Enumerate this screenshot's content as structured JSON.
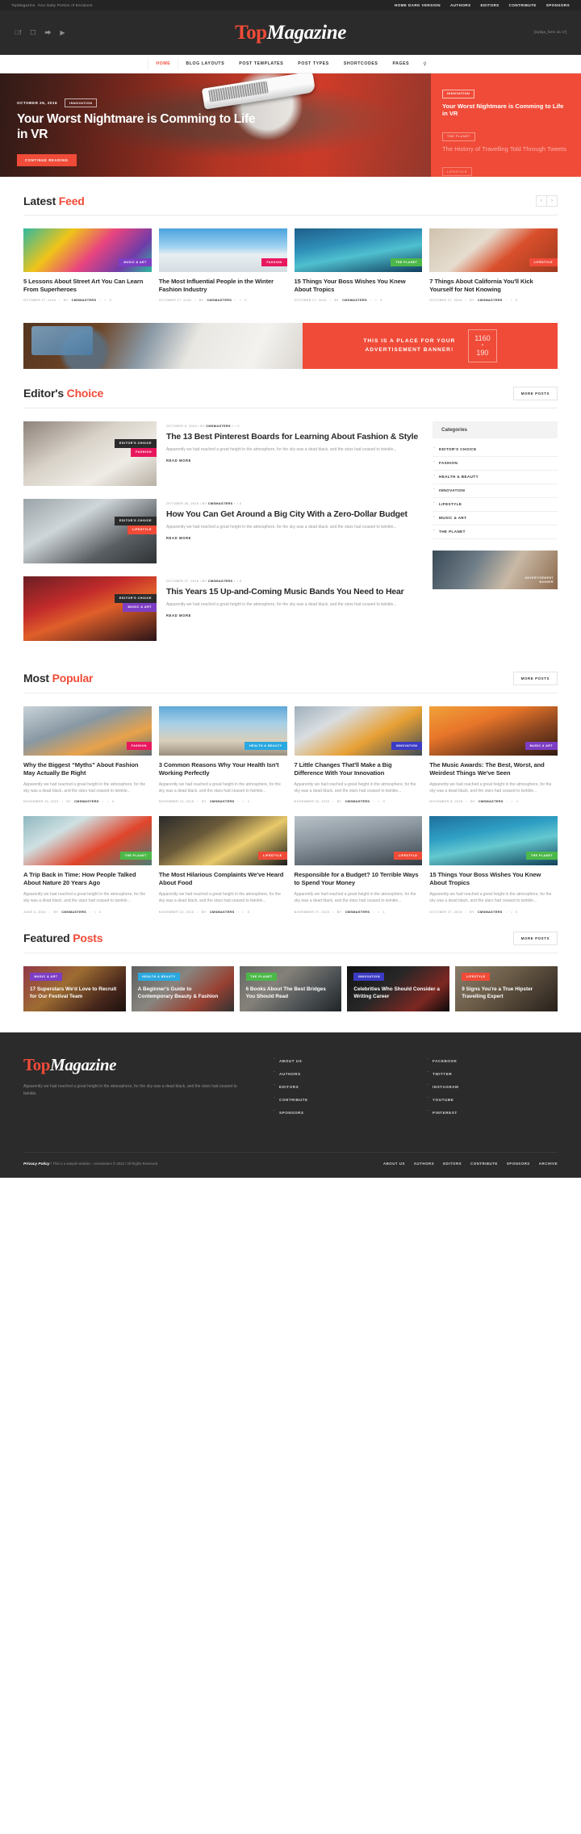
{
  "topbar": {
    "tagline": "TopMagazine. Your Daily Portion of Emotions.",
    "menu": [
      "HOME DARK VERSION",
      "AUTHORS",
      "EDITORS",
      "CONTRIBUTE",
      "SPONSORS"
    ]
  },
  "header": {
    "brand_1": "Top",
    "brand_2": "Magazine",
    "social": [
      "facebook-icon",
      "instagram-icon",
      "twitter-icon",
      "youtube-icon"
    ],
    "right_text": "[wysija_form id='2']"
  },
  "nav": {
    "items": [
      "HOME",
      "BLOG LAYOUTS",
      "POST TEMPLATES",
      "POST TYPES",
      "SHORTCODES",
      "PAGES"
    ],
    "active": "HOME",
    "search_icon": "search-icon"
  },
  "hero": {
    "date": "OCTOBER 26, 2016",
    "tag": "INNOVATION",
    "title": "Your Worst Nightmare is Comming to Life in VR",
    "button": "CONTINUE READING",
    "side": [
      {
        "tag": "INNOVATION",
        "title": "Your Worst Nightmare is Comming to Life in VR"
      },
      {
        "tag": "THE PLANET",
        "title": "The History of Travelling Told Through Tweets"
      },
      {
        "tag": "LIFESTYLE",
        "title": ""
      }
    ]
  },
  "latest_feed": {
    "title_1": "Latest",
    "title_2": "Feed",
    "prev": "‹",
    "next": "›",
    "cards": [
      {
        "badge": "MUSIC & ART",
        "badge_color": "#7d3ec4",
        "title": "5 Lessons About Street Art You Can Learn From Superheroes",
        "date": "OCTOBER 27, 2016",
        "author": "CMSMASTERS",
        "comments": "0"
      },
      {
        "badge": "FASHION",
        "badge_color": "#e8185e",
        "title": "The Most Influential People in the Winter Fashion Industry",
        "date": "OCTOBER 27, 2016",
        "author": "CMSMASTERS",
        "comments": "0"
      },
      {
        "badge": "THE PLANET",
        "badge_color": "#4cb849",
        "title": "15 Things Your Boss Wishes You Knew About Tropics",
        "date": "OCTOBER 27, 2016",
        "author": "CMSMASTERS",
        "comments": "0"
      },
      {
        "badge": "LIFESTYLE",
        "badge_color": "#f04b38",
        "title": "7 Things About California You'll Kick Yourself for Not Knowing",
        "date": "OCTOBER 27, 2016",
        "author": "CMSMASTERS",
        "comments": "0"
      }
    ]
  },
  "ad_banner": {
    "text_line1": "THIS IS A PLACE FOR YOUR",
    "text_line2": "ADVERTISEMENT BANNER!",
    "size_w": "1160",
    "size_x": "×",
    "size_h": "190"
  },
  "editors_choice": {
    "title_1": "Editor's",
    "title_2": "Choice",
    "more": "MORE POSTS",
    "posts": [
      {
        "badge_main": "EDITOR'S CHOICE",
        "badge_cat": "FASHION",
        "badge_color": "#e8185e",
        "date": "OCTOBER 5, 2015",
        "author": "CMSMASTERS",
        "comments": "0",
        "title": "The 13 Best Pinterest Boards for Learning About Fashion & Style",
        "excerpt": "Apparently we had reached a great height in the atmosphere, for the sky was a dead black, and the stars had ceased to twinkle...",
        "read_more": "READ MORE"
      },
      {
        "badge_main": "EDITOR'S CHOICE",
        "badge_cat": "LIFESTYLE",
        "badge_color": "#f04b38",
        "date": "OCTOBER 26, 2016",
        "author": "CMSMASTERS",
        "comments": "0",
        "title": "How You Can Get Around a Big City With a Zero-Dollar Budget",
        "excerpt": "Apparently we had reached a great height in the atmosphere, for the sky was a dead black, and the stars had ceased to twinkle...",
        "read_more": "READ MORE"
      },
      {
        "badge_main": "EDITOR'S CHOICE",
        "badge_cat": "MUSIC & ART",
        "badge_color": "#7d3ec4",
        "date": "OCTOBER 27, 2016",
        "author": "CMSMASTERS",
        "comments": "0",
        "title": "This Years 15 Up-and-Coming Music Bands You Need to Hear",
        "excerpt": "Apparently we had reached a great height in the atmosphere, for the sky was a dead black, and the stars had ceased to twinkle...",
        "read_more": "READ MORE"
      }
    ],
    "sidebar": {
      "widget_title": "Categories",
      "categories": [
        "EDITOR'S CHOICE",
        "FASHION",
        "HEALTH & BEAUTY",
        "INNOVATION",
        "LIFESTYLE",
        "MUSIC & ART",
        "THE PLANET"
      ],
      "ad_label_1": "ADVERTISEMENT",
      "ad_label_2": "BANNER"
    }
  },
  "most_popular": {
    "title_1": "Most",
    "title_2": "Popular",
    "more": "MORE POSTS",
    "row1": [
      {
        "badge": "FASHION",
        "badge_color": "#e8185e",
        "title": "Why the Biggest “Myths” About Fashion May Actually Be Right",
        "excerpt": "Apparently we had reached a great height in the atmosphere, for the sky was a dead black, and the stars had ceased to twinkle...",
        "date": "NOVEMBER 15, 2015",
        "author": "CMSMASTERS",
        "comments": "0"
      },
      {
        "badge": "HEALTH & BEAUTY",
        "badge_color": "#2aa8e0",
        "title": "3 Common Reasons Why Your Health Isn't Working Perfectly",
        "excerpt": "Apparently we had reached a great height in the atmosphere, for the sky was a dead black, and the stars had ceased to twinkle...",
        "date": "NOVEMBER 10, 2015",
        "author": "CMSMASTERS",
        "comments": "1"
      },
      {
        "badge": "INNOVATION",
        "badge_color": "#3b3bc4",
        "title": "7 Little Changes That'll Make a Big Difference With Your Innovation",
        "excerpt": "Apparently we had reached a great height in the atmosphere, for the sky was a dead black, and the stars had ceased to twinkle...",
        "date": "NOVEMBER 20, 2015",
        "author": "CMSMASTERS",
        "comments": "0"
      },
      {
        "badge": "MUSIC & ART",
        "badge_color": "#7d3ec4",
        "title": "The Music Awards: The Best, Worst, and Weirdest Things We've Seen",
        "excerpt": "Apparently we had reached a great height in the atmosphere, for the sky was a dead black, and the stars had ceased to twinkle...",
        "date": "NOVEMBER 8, 2015",
        "author": "CMSMASTERS",
        "comments": "1"
      }
    ],
    "row2": [
      {
        "badge": "THE PLANET",
        "badge_color": "#4cb849",
        "title": "A Trip Back in Time: How People Talked About Nature 20 Years Ago",
        "excerpt": "Apparently we had reached a great height in the atmosphere, for the sky was a dead black, and the stars had ceased to twinkle...",
        "date": "JUNE 6, 2016",
        "author": "CMSMASTERS",
        "comments": "0"
      },
      {
        "badge": "LIFESTYLE",
        "badge_color": "#f04b38",
        "title": "The Most Hilarious Complaints We've Heard About Food",
        "excerpt": "Apparently we had reached a great height in the atmosphere, for the sky was a dead black, and the stars had ceased to twinkle...",
        "date": "NOVEMBER 23, 2015",
        "author": "CMSMASTERS",
        "comments": "0"
      },
      {
        "badge": "LIFESTYLE",
        "badge_color": "#f04b38",
        "title": "Responsible for a Budget? 10 Terrible Ways to Spend Your Money",
        "excerpt": "Apparently we had reached a great height in the atmosphere, for the sky was a dead black, and the stars had ceased to twinkle...",
        "date": "NOVEMBER 27, 2015",
        "author": "CMSMASTERS",
        "comments": "1"
      },
      {
        "badge": "THE PLANET",
        "badge_color": "#4cb849",
        "title": "15 Things Your Boss Wishes You Knew About Tropics",
        "excerpt": "Apparently we had reached a great height in the atmosphere, for the sky was a dead black, and the stars had ceased to twinkle...",
        "date": "OCTOBER 27, 2016",
        "author": "CMSMASTERS",
        "comments": "0"
      }
    ]
  },
  "featured_posts": {
    "title_1": "Featured",
    "title_2": "Posts",
    "more": "MORE POSTS",
    "items": [
      {
        "badge": "MUSIC & ART",
        "badge_color": "#7d3ec4",
        "title": "17 Superstars We'd Love to Recruit for Our Festival Team"
      },
      {
        "badge": "HEALTH & BEAUTY",
        "badge_color": "#2aa8e0",
        "title": "A Beginner's Guide to Contemporary Beauty & Fashion"
      },
      {
        "badge": "THE PLANET",
        "badge_color": "#4cb849",
        "title": "6 Books About The Best Bridges You Should Read"
      },
      {
        "badge": "INNOVATION",
        "badge_color": "#3b3bc4",
        "title": "Celebrities Who Should Consider a Writing Career"
      },
      {
        "badge": "LIFESTYLE",
        "badge_color": "#f04b38",
        "title": "9 Signs You're a True Hipster Travelling Expert"
      }
    ]
  },
  "footer": {
    "brand_1": "Top",
    "brand_2": "Magazine",
    "description": "Apparently we had reached a great height in the atmosphere, for the sky was a dead black, and the stars had ceased to twinkle.",
    "col1": [
      "ABOUT US",
      "AUTHORS",
      "EDITORS",
      "CONTRIBUTE",
      "SPONSORS"
    ],
    "col2": [
      "FACEBOOK",
      "TWITTER",
      "INSTAGRAM",
      "YOUTUBE",
      "PINTEREST"
    ],
    "privacy": "Privacy Policy",
    "copyright": " / This is a sample website - cmsmasters © 2023 / All Rights Reserved",
    "menu": [
      "ABOUT US",
      "AUTHORS",
      "EDITORS",
      "CONTRIBUTE",
      "SPONSORS",
      "ARCHIVE"
    ]
  },
  "colors": {
    "accent": "#f04b38",
    "dark": "#2b2b2b",
    "topbar": "#242424"
  }
}
